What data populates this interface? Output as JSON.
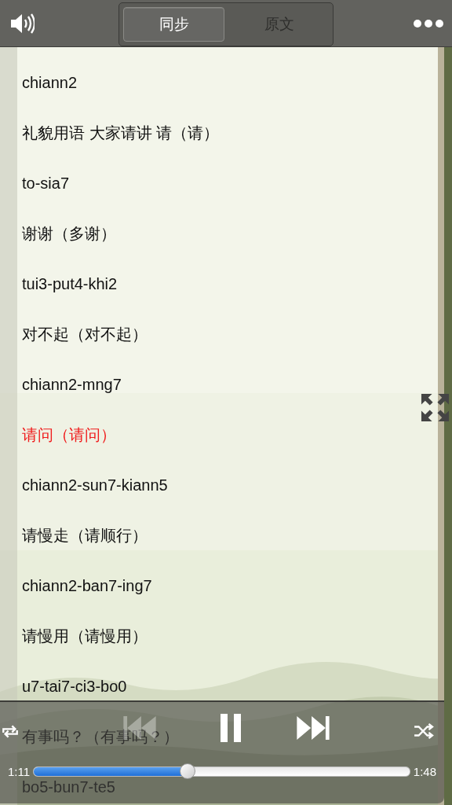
{
  "tabs": [
    {
      "label": "同步",
      "selected": true
    },
    {
      "label": "原文",
      "selected": false
    }
  ],
  "lyrics": [
    {
      "text": "chiann2",
      "current": false
    },
    {
      "text": "礼貌用语 大家请讲  请（请）",
      "current": false
    },
    {
      "text": "to-sia7",
      "current": false
    },
    {
      "text": "谢谢（多谢）",
      "current": false
    },
    {
      "text": "tui3-put4-khi2",
      "current": false
    },
    {
      "text": "对不起（对不起）",
      "current": false
    },
    {
      "text": "chiann2-mng7",
      "current": false
    },
    {
      "text": "请问（请问）",
      "current": true
    },
    {
      "text": "chiann2-sun7-kiann5",
      "current": false
    },
    {
      "text": "请慢走（请顺行）",
      "current": false
    },
    {
      "text": "chiann2-ban7-ing7",
      "current": false
    },
    {
      "text": "请慢用（请慢用）",
      "current": false
    },
    {
      "text": "u7-tai7-ci3-bo0",
      "current": false
    },
    {
      "text": "有事吗？（有事吗？）",
      "current": false
    },
    {
      "text": "bo5-bun7-te5",
      "current": false
    }
  ],
  "player": {
    "prev_disabled": true,
    "elapsed": "1:11",
    "total": "1:48",
    "level": 0.41
  }
}
